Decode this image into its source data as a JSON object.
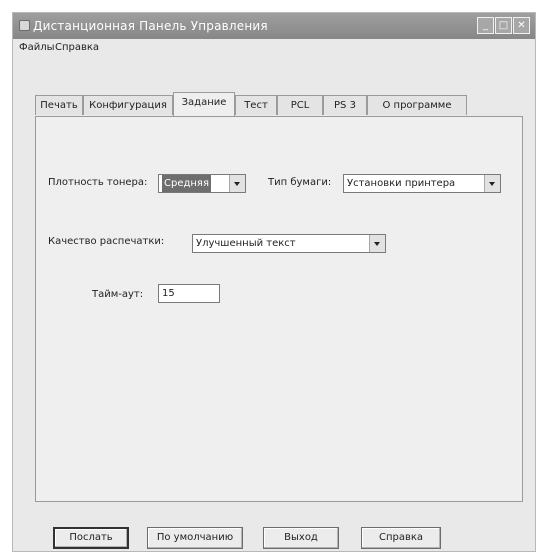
{
  "window": {
    "title": "Дистанционная Панель Управления",
    "controls": {
      "minimize": "_",
      "maximize": "□",
      "close": "✕"
    }
  },
  "menu": {
    "items": [
      "Файлы",
      "Справка"
    ]
  },
  "tabs": [
    {
      "label": "Печать",
      "active": false
    },
    {
      "label": "Конфигурация",
      "active": false
    },
    {
      "label": "Задание",
      "active": true
    },
    {
      "label": "Тест",
      "active": false
    },
    {
      "label": "PCL",
      "active": false
    },
    {
      "label": "PS 3",
      "active": false
    },
    {
      "label": "О программе",
      "active": false
    }
  ],
  "form": {
    "toner_density": {
      "label": "Плотность тонера:",
      "value": "Средняя"
    },
    "paper_type": {
      "label": "Тип бумаги:",
      "value": "Установки принтера"
    },
    "print_quality": {
      "label": "Качество распечатки:",
      "value": "Улучшенный текст"
    },
    "timeout": {
      "label": "Тайм-аут:",
      "value": "15"
    }
  },
  "buttons": {
    "send": "Послать",
    "default": "По умолчанию",
    "exit": "Выход",
    "help": "Справка"
  }
}
